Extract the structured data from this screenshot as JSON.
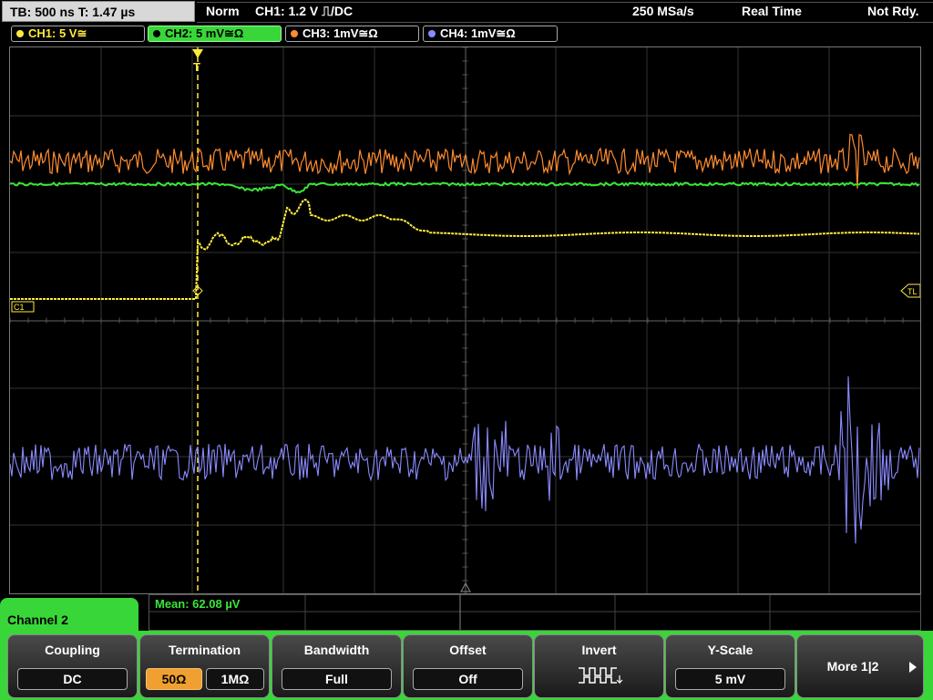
{
  "top": {
    "timebase": "TB: 500 ns   T: 1.47 µs",
    "trigger_mode": "Norm",
    "trigger_info": "CH1: 1.2 V ⎍/DC",
    "sample_rate": "250 MSa/s",
    "acq_mode": "Real Time",
    "status": "Not Rdy."
  },
  "channels": [
    {
      "label": "CH1: 5 V≅",
      "color": "#ffeb3b"
    },
    {
      "label": "CH2: 5 mV≅Ω",
      "color": "#39e639"
    },
    {
      "label": "CH3: 1mV≅Ω",
      "color": "#ff8c30"
    },
    {
      "label": "CH4: 1mV≅Ω",
      "color": "#8a8aff"
    }
  ],
  "markers": {
    "c1": "C1",
    "tl": "TL"
  },
  "measurement": "Mean: 62.08 µV",
  "menu_title": "Channel 2",
  "softkeys": {
    "coupling": {
      "title": "Coupling",
      "value": "DC"
    },
    "termination": {
      "title": "Termination",
      "opt1": "50Ω",
      "opt2": "1MΩ"
    },
    "bandwidth": {
      "title": "Bandwidth",
      "value": "Full"
    },
    "offset": {
      "title": "Offset",
      "value": "Off"
    },
    "invert": {
      "title": "Invert"
    },
    "yscale": {
      "title": "Y-Scale",
      "value": "5 mV"
    },
    "more": {
      "label": "More 1|2"
    }
  }
}
